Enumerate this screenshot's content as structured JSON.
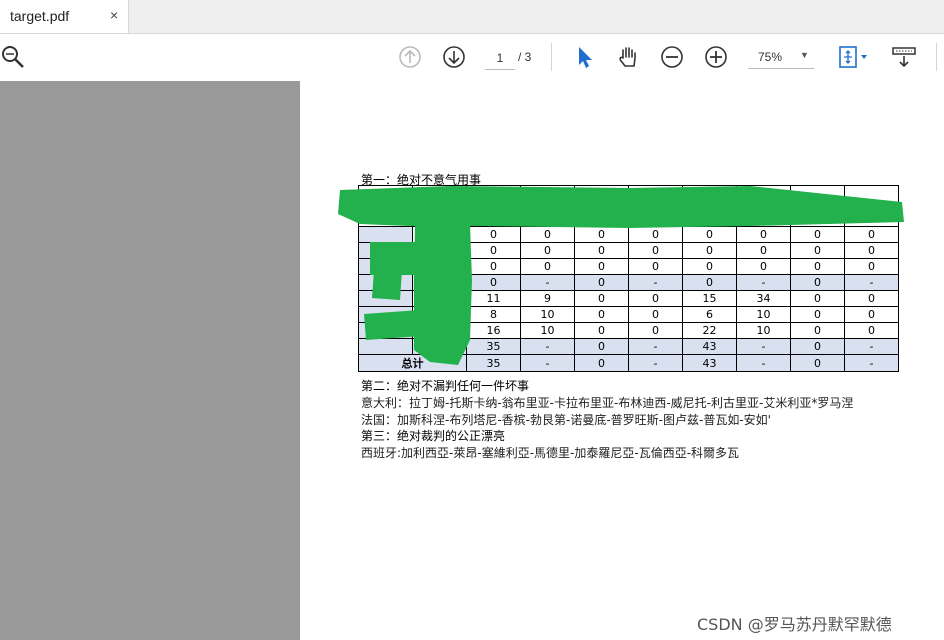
{
  "tab": {
    "title": "target.pdf",
    "close": "×"
  },
  "toolbar": {
    "page_current": "1",
    "page_total": "/ 3",
    "zoom": "75%",
    "zoom_caret": "▼"
  },
  "doc": {
    "heading1": "第一：绝对不意气用事",
    "table": {
      "rows": [
        [
          "0",
          "0",
          "0",
          "0",
          "0",
          "0",
          "0",
          "0"
        ],
        [
          "0",
          "0",
          "0",
          "0",
          "0",
          "0",
          "0",
          "0"
        ],
        [
          "0",
          "0",
          "0",
          "0",
          "0",
          "0",
          "0",
          "0"
        ],
        [
          "0",
          "-",
          "0",
          "-",
          "0",
          "-",
          "0",
          "-"
        ],
        [
          "11",
          "9",
          "0",
          "0",
          "15",
          "34",
          "0",
          "0"
        ],
        [
          "8",
          "10",
          "0",
          "0",
          "6",
          "10",
          "0",
          "0"
        ],
        [
          "16",
          "10",
          "0",
          "0",
          "22",
          "10",
          "0",
          "0"
        ],
        [
          "35",
          "-",
          "0",
          "-",
          "43",
          "-",
          "0",
          "-"
        ],
        [
          "35",
          "-",
          "0",
          "-",
          "43",
          "-",
          "0",
          "-"
        ]
      ],
      "total_label": "总计"
    },
    "heading2": "第二：绝对不漏判任何一件坏事",
    "italy": "意大利：拉丁姆-托斯卡纳-翁布里亚-卡拉布里亚-布林迪西-威尼托-利古里亚-艾米利亚*罗马涅",
    "france": "法国：加斯科涅-布列塔尼-香槟-勃艮第-诺曼底-普罗旺斯-图卢兹-普瓦如-安如'",
    "heading3": "第三：绝对裁判的公正漂亮",
    "spain": "西班牙:加利西亞-萊昂-塞維利亞-馬德里-加泰羅尼亞-瓦倫西亞-科爾多瓦"
  },
  "watermark": "CSDN @罗马苏丹默罕默德",
  "colors": {
    "scribble": "#22b14c",
    "subtotal": "#d9e0f0",
    "leftpane": "#999999"
  }
}
